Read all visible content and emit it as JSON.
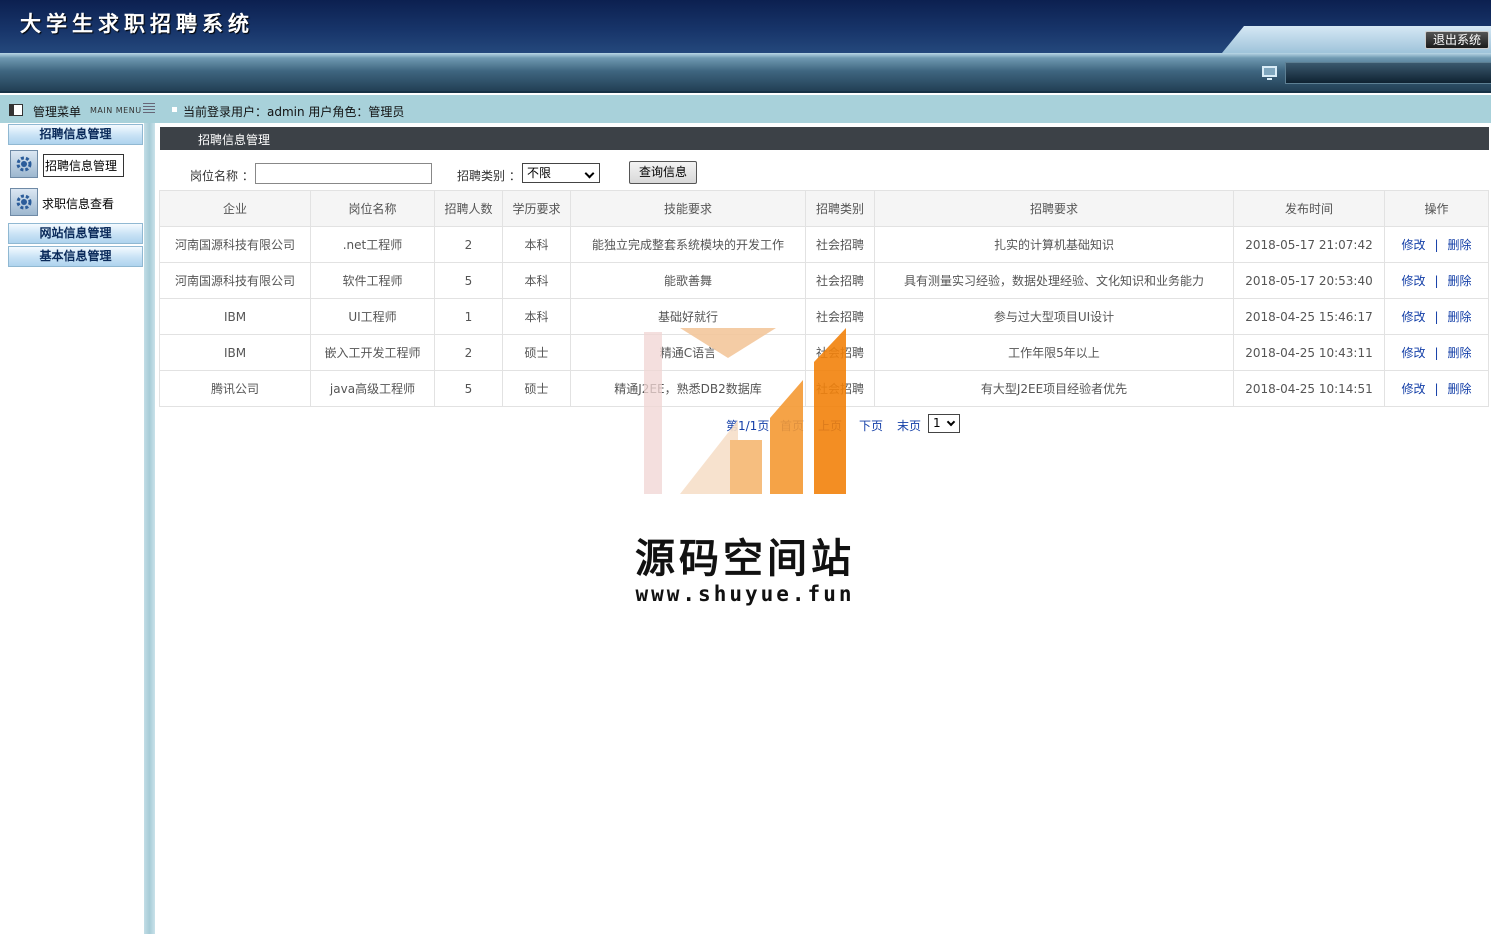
{
  "header": {
    "title": "大学生求职招聘系统",
    "logout_label": "退出系统"
  },
  "infobar": {
    "menu_label": "管理菜单",
    "menu_sub": "MAIN MENU",
    "user_info": "当前登录用户：admin  用户角色：管理员"
  },
  "sidebar": {
    "groups": [
      {
        "label": "招聘信息管理"
      },
      {
        "label": "网站信息管理"
      },
      {
        "label": "基本信息管理"
      }
    ],
    "items": [
      {
        "label": "招聘信息管理",
        "icon": "gear-icon"
      },
      {
        "label": "求职信息查看",
        "icon": "gear-icon"
      }
    ]
  },
  "main": {
    "title": "招聘信息管理",
    "search": {
      "position_label": "岗位名称 ：",
      "position_value": "",
      "type_label": "招聘类别 ：",
      "type_value": "不限",
      "query_label": "查询信息"
    },
    "columns": [
      "企业",
      "岗位名称",
      "招聘人数",
      "学历要求",
      "技能要求",
      "招聘类别",
      "招聘要求",
      "发布时间",
      "操作"
    ],
    "rows": [
      {
        "company": "河南国源科技有限公司",
        "position": ".net工程师",
        "count": "2",
        "education": "本科",
        "skills": "能独立完成整套系统模块的开发工作",
        "category": "社会招聘",
        "requirements": "扎实的计算机基础知识",
        "time": "2018-05-17 21:07:42"
      },
      {
        "company": "河南国源科技有限公司",
        "position": "软件工程师",
        "count": "5",
        "education": "本科",
        "skills": "能歌善舞",
        "category": "社会招聘",
        "requirements": "具有测量实习经验，数据处理经验、文化知识和业务能力",
        "time": "2018-05-17 20:53:40"
      },
      {
        "company": "IBM",
        "position": "UI工程师",
        "count": "1",
        "education": "本科",
        "skills": "基础好就行",
        "category": "社会招聘",
        "requirements": "参与过大型项目UI设计",
        "time": "2018-04-25 15:46:17"
      },
      {
        "company": "IBM",
        "position": "嵌入工开发工程师",
        "count": "2",
        "education": "硕士",
        "skills": "精通C语言",
        "category": "社会招聘",
        "requirements": "工作年限5年以上",
        "time": "2018-04-25 10:43:11"
      },
      {
        "company": "腾讯公司",
        "position": "java高级工程师",
        "count": "5",
        "education": "硕士",
        "skills": "精通J2EE，熟悉DB2数据库",
        "category": "社会招聘",
        "requirements": "有大型J2EE项目经验者优先",
        "time": "2018-04-25 10:14:51"
      }
    ],
    "actions": {
      "edit": "修改",
      "sep": "|",
      "delete": "删除"
    },
    "pager": {
      "info": "第1/1页",
      "first": "首页",
      "prev": "上页",
      "next": "下页",
      "last": "末页",
      "selected": "1"
    }
  },
  "watermark": {
    "text": "源码空间站",
    "url": "www.shuyue.fun"
  }
}
